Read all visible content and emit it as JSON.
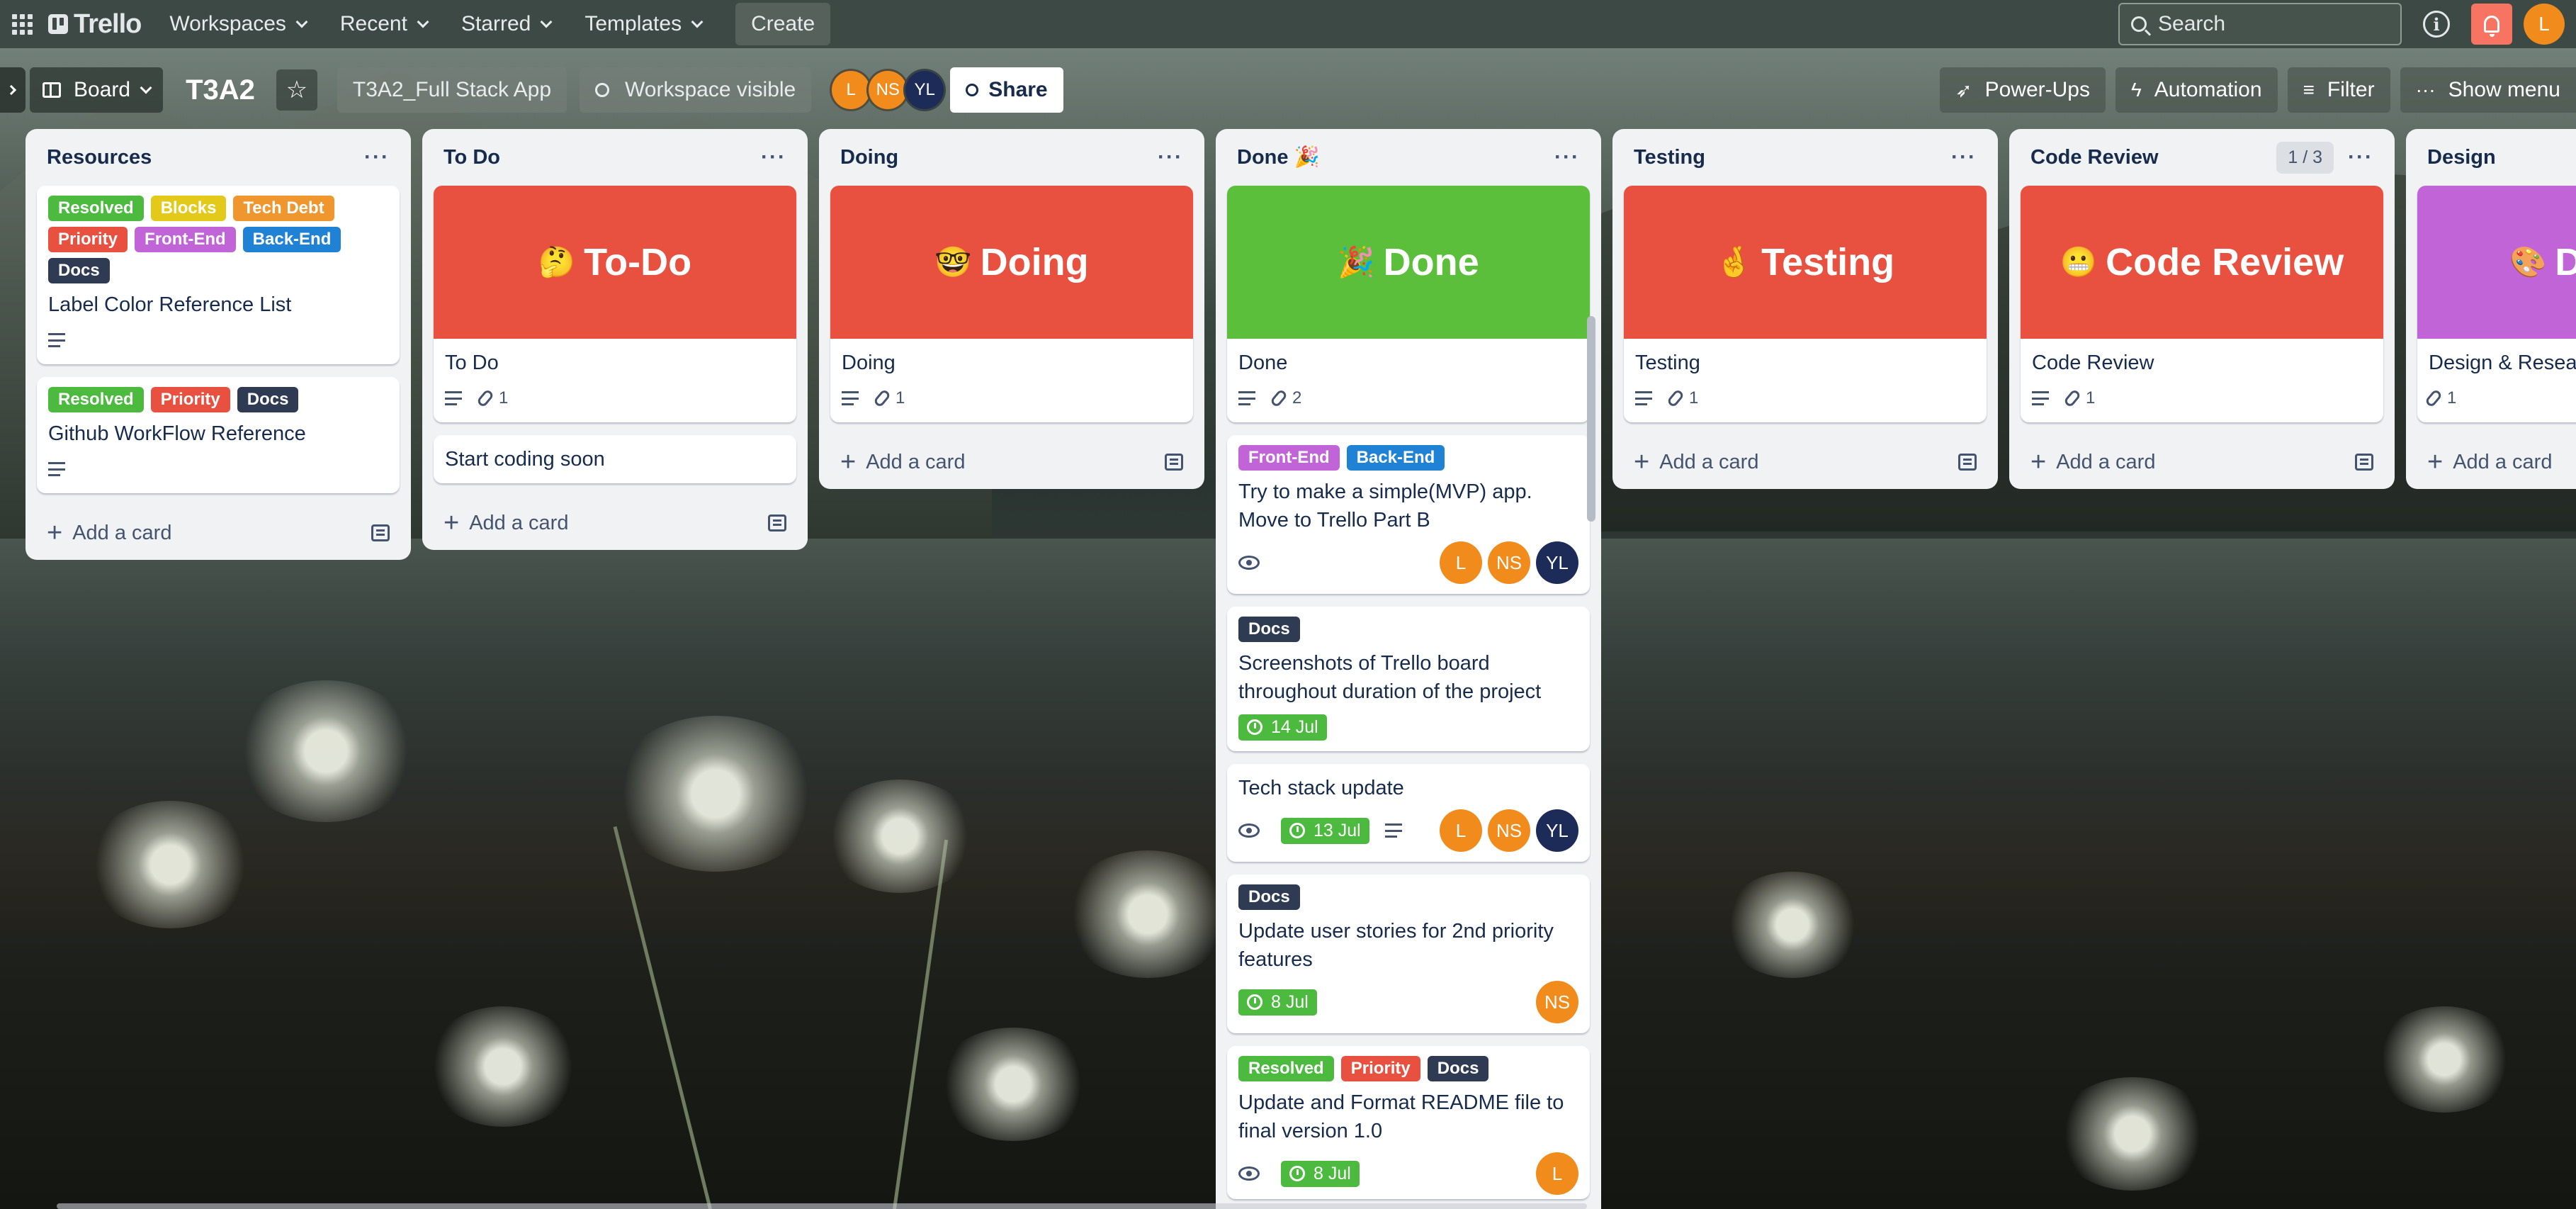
{
  "topnav": {
    "brand": "Trello",
    "menus": [
      "Workspaces",
      "Recent",
      "Starred",
      "Templates"
    ],
    "create_label": "Create",
    "search_placeholder": "Search",
    "user_initial": "L"
  },
  "board": {
    "view_label": "Board",
    "title": "T3A2",
    "workspace_name": "T3A2_Full Stack App",
    "visibility_label": "Workspace visible",
    "members": [
      "L",
      "NS",
      "YL"
    ],
    "share_label": "Share",
    "powerups_label": "Power-Ups",
    "automation_label": "Automation",
    "filter_label": "Filter",
    "show_menu_label": "Show menu"
  },
  "colors": {
    "resolved": "#4bce97",
    "blocks": "#f5cd47",
    "tech_debt": "#fea362",
    "priority": "#f87168",
    "front_end": "#c97cf4",
    "back_end": "#1f82d4",
    "docs": "#44546f"
  },
  "common": {
    "add_card": "Add a card"
  },
  "lists": {
    "resources": {
      "title": "Resources",
      "cards": [
        {
          "labels": [
            "Resolved",
            "Blocks",
            "Tech Debt",
            "Priority",
            "Front-End",
            "Back-End",
            "Docs"
          ],
          "title": "Label Color Reference List"
        },
        {
          "labels": [
            "Resolved",
            "Priority",
            "Docs"
          ],
          "title": "Github WorkFlow Reference"
        }
      ]
    },
    "todo": {
      "title": "To Do",
      "cover_text": "To-Do",
      "cards": [
        {
          "title": "To Do",
          "attachments": "1"
        },
        {
          "title": "Start coding soon"
        }
      ]
    },
    "doing": {
      "title": "Doing",
      "cover_text": "Doing",
      "cards": [
        {
          "title": "Doing",
          "attachments": "1"
        }
      ]
    },
    "done": {
      "title": "Done 🎉",
      "cover_text": "Done",
      "cards": [
        {
          "title": "Done",
          "attachments": "2"
        },
        {
          "labels": [
            "Front-End",
            "Back-End"
          ],
          "title": "Try to make a simple(MVP) app. Move to Trello Part B",
          "members": [
            "L",
            "NS",
            "YL"
          ]
        },
        {
          "labels": [
            "Docs"
          ],
          "title": "Screenshots of Trello board throughout duration of the project",
          "due": "14 Jul"
        },
        {
          "title": "Tech stack update",
          "due": "13 Jul",
          "members": [
            "L",
            "NS",
            "YL"
          ]
        },
        {
          "labels": [
            "Docs"
          ],
          "title": "Update user stories for 2nd priority features",
          "due": "8 Jul",
          "members": [
            "NS"
          ]
        },
        {
          "labels": [
            "Resolved",
            "Priority",
            "Docs"
          ],
          "title": "Update and Format README file to final version 1.0",
          "due": "8 Jul",
          "members": [
            "L"
          ]
        }
      ]
    },
    "testing": {
      "title": "Testing",
      "cover_text": "Testing",
      "cards": [
        {
          "title": "Testing",
          "attachments": "1"
        }
      ]
    },
    "code_review": {
      "title": "Code Review",
      "count": "1 / 3",
      "cover_text": "Code Review",
      "cards": [
        {
          "title": "Code Review",
          "attachments": "1"
        }
      ]
    },
    "design": {
      "title": "Design",
      "cover_text": "De",
      "cards": [
        {
          "title": "Design & Resear",
          "attachments": "1"
        }
      ]
    }
  }
}
